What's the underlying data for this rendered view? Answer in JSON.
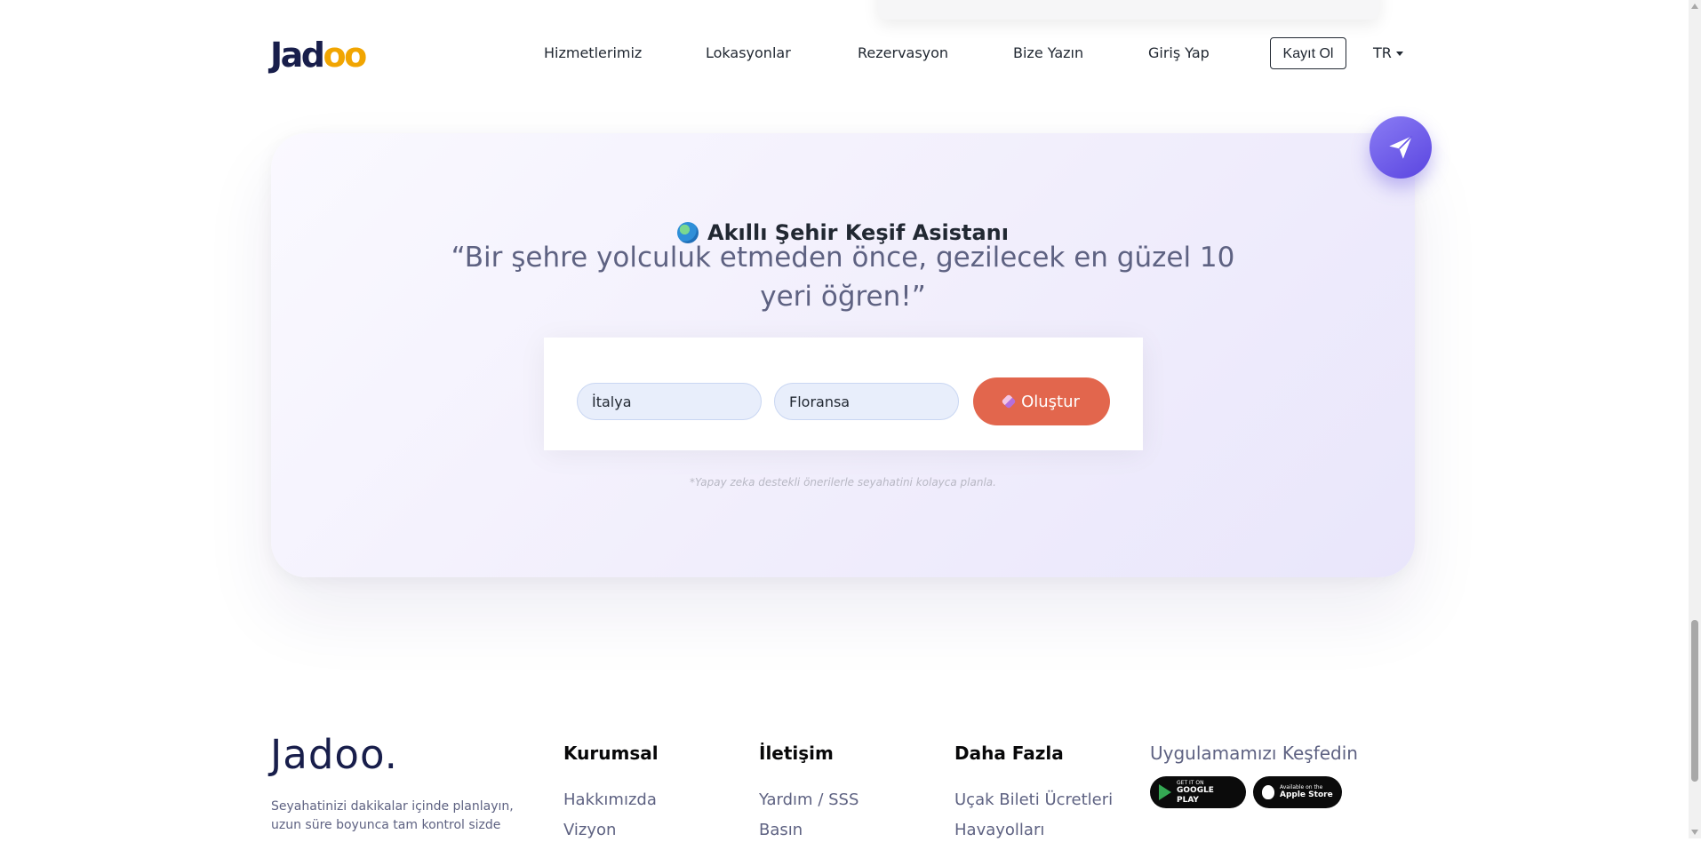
{
  "navbar": {
    "logo_prefix": "Jad",
    "logo_suffix": "oo",
    "links": [
      "Hizmetlerimiz",
      "Lokasyonlar",
      "Rezervasyon",
      "Bize Yazın",
      "Giriş Yap"
    ],
    "signup_label": "Kayıt Ol",
    "language": "TR"
  },
  "assistant": {
    "title": "Akıllı Şehir Keşif Asistanı",
    "quote": "“Bir şehre yolculuk etmeden önce, gezilecek en güzel 10 yeri öğren!”",
    "country_value": "İtalya",
    "city_value": "Floransa",
    "button_label": "Oluştur",
    "footnote": "*Yapay zeka destekli önerilerle seyahatini kolayca planla."
  },
  "footer": {
    "logo": "Jadoo.",
    "description": "Seyahatinizi dakikalar içinde planlayın, uzun süre boyunca tam kontrol sizde",
    "columns": [
      {
        "heading": "Kurumsal",
        "links": [
          "Hakkımızda",
          "Vizyon"
        ]
      },
      {
        "heading": "İletişim",
        "links": [
          "Yardım / SSS",
          "Basın"
        ]
      },
      {
        "heading": "Daha Fazla",
        "links": [
          "Uçak Bileti Ücretleri",
          "Havayolları"
        ]
      }
    ],
    "app": {
      "heading": "Uygulamamızı Keşfedin",
      "google_small": "GET IT ON",
      "google_big": "GOOGLE PLAY",
      "apple_small": "Available on the",
      "apple_big": "Apple Store"
    }
  },
  "colors": {
    "accent": "#e2664d",
    "brand_yellow": "#f1a501",
    "send_button": "#6a57e8",
    "text_dark": "#181e4b",
    "text_muted": "#5e6282"
  }
}
